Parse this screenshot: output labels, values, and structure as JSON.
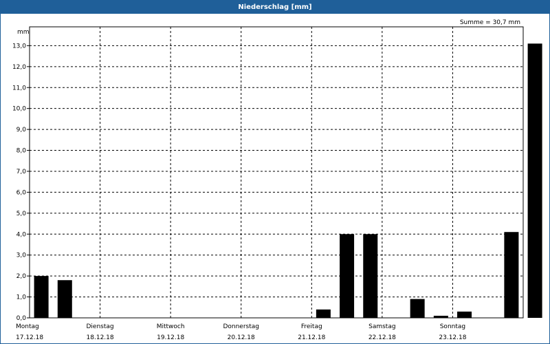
{
  "window": {
    "title": "Niederschlag [mm]"
  },
  "chart_data": {
    "type": "bar",
    "title": "Niederschlag [mm]",
    "ylabel": "mm",
    "annotation": "Summe = 30,7 mm",
    "ylim": [
      0,
      13.9
    ],
    "yticks": [
      "0.0",
      "1.0",
      "2.0",
      "3.0",
      "4.0",
      "5.0",
      "6.0",
      "7.0",
      "8.0",
      "9.0",
      "10.0",
      "11.0",
      "12.0",
      "13.0"
    ],
    "ytick_labels": [
      "0,0",
      "1,0",
      "2,0",
      "3,0",
      "4,0",
      "5,0",
      "6,0",
      "7,0",
      "8,0",
      "9,0",
      "10,0",
      "11,0",
      "12,0",
      "13,0"
    ],
    "grid": true,
    "days": [
      {
        "day": "Montag",
        "date": "17.12.18"
      },
      {
        "day": "Dienstag",
        "date": "18.12.18"
      },
      {
        "day": "Mittwoch",
        "date": "19.12.18"
      },
      {
        "day": "Donnerstag",
        "date": "20.12.18"
      },
      {
        "day": "Freitag",
        "date": "21.12.18"
      },
      {
        "day": "Samstag",
        "date": "22.12.18"
      },
      {
        "day": "Sonntag",
        "date": "23.12.18"
      }
    ],
    "bars_per_day": 3,
    "values": [
      2.0,
      1.8,
      0,
      0,
      0,
      0,
      0,
      0,
      0,
      0,
      0,
      0,
      0.4,
      4.0,
      4.0,
      0,
      0.9,
      0.1,
      0.3,
      0,
      4.1,
      13.1
    ],
    "bar_color": "#000000",
    "grid_color": "#000000"
  }
}
